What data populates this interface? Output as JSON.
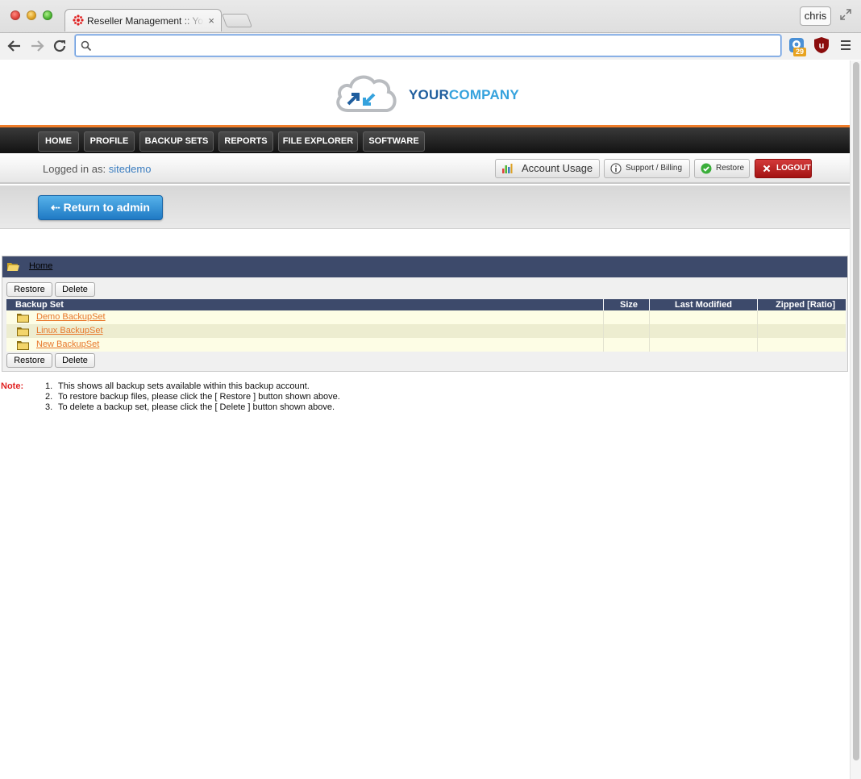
{
  "browser": {
    "tab_title": "Reseller Management :: You",
    "tab_close": "×",
    "profile_name": "chris",
    "address_value": "",
    "extension_badge": "29"
  },
  "header": {
    "logo_primary": "YOUR",
    "logo_secondary": "COMPANY"
  },
  "nav": {
    "items": [
      {
        "label": "HOME"
      },
      {
        "label": "PROFILE"
      },
      {
        "label": "BACKUP SETS"
      },
      {
        "label": "REPORTS"
      },
      {
        "label": "FILE EXPLORER"
      },
      {
        "label": "SOFTWARE"
      }
    ]
  },
  "userbar": {
    "logged_in_label": "Logged in as:",
    "username": "sitedemo",
    "account_usage": "Account Usage",
    "support_billing": "Support / Billing",
    "restore": "Restore",
    "logout": "LOGOUT"
  },
  "admin": {
    "return_label": "Return to admin"
  },
  "explorer": {
    "breadcrumb_home": "Home",
    "restore_button": "Restore",
    "delete_button": "Delete",
    "columns": [
      "Backup Set",
      "Size",
      "Last Modified",
      "Zipped [Ratio]"
    ],
    "rows": [
      {
        "name": "Demo BackupSet",
        "size": "",
        "modified": "",
        "zipped": ""
      },
      {
        "name": "Linux BackupSet",
        "size": "",
        "modified": "",
        "zipped": ""
      },
      {
        "name": "New BackupSet",
        "size": "",
        "modified": "",
        "zipped": ""
      }
    ]
  },
  "notes": {
    "label": "Note:",
    "items": [
      {
        "num": "1.",
        "text": "This shows all backup sets available within this backup account."
      },
      {
        "num": "2.",
        "text": "To restore backup files, please click the [ Restore ] button shown above."
      },
      {
        "num": "3.",
        "text": "To delete a backup set, please click the [ Delete ] button shown above."
      }
    ]
  },
  "colors": {
    "nav_accent": "#ef7d2a",
    "table_header": "#3d4a6b",
    "link": "#e8772a",
    "note_label": "#e02222",
    "logo_dark": "#1f5e9e",
    "logo_light": "#35a2dd"
  }
}
